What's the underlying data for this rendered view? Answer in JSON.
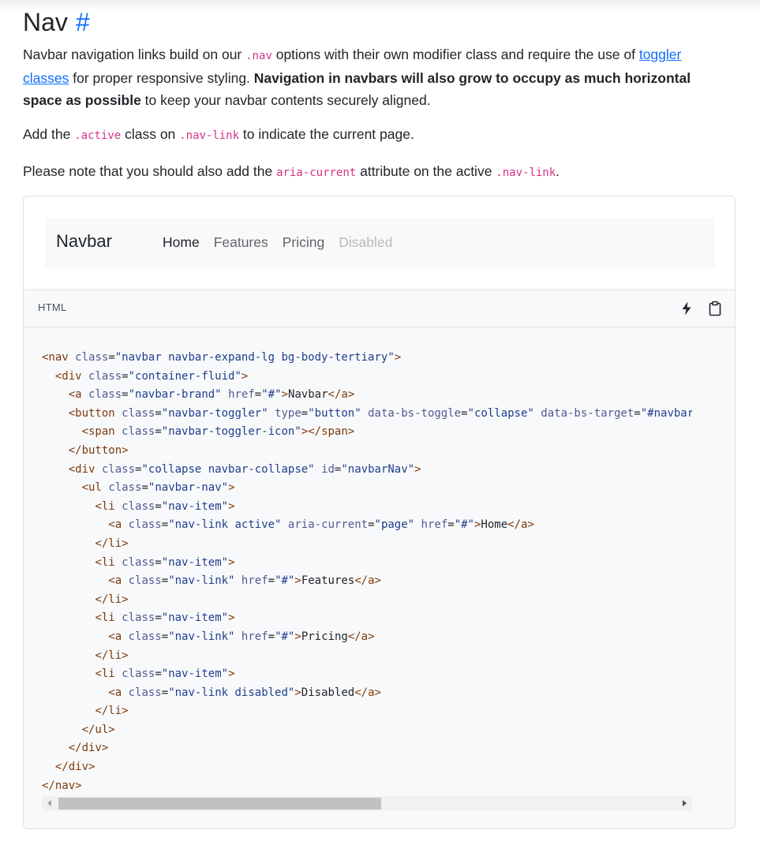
{
  "section": {
    "title": "Nav",
    "anchor": "#"
  },
  "intro": {
    "p1_a": "Navbar navigation links build on our ",
    "p1_code": ".nav",
    "p1_b": " options with their own modifier class and require the use of ",
    "p1_link": "toggler classes",
    "p1_c": " for proper responsive styling. ",
    "p1_bold": "Navigation in navbars will also grow to occupy as much horizontal space as possible",
    "p1_d": " to keep your navbar contents securely aligned.",
    "p2_a": "Add the ",
    "p2_code1": ".active",
    "p2_b": " class on ",
    "p2_code2": ".nav-link",
    "p2_c": " to indicate the current page.",
    "p3_a": "Please note that you should also add the ",
    "p3_code1": "aria-current",
    "p3_b": " attribute on the active ",
    "p3_code2": ".nav-link",
    "p3_c": "."
  },
  "preview": {
    "brand": "Navbar",
    "links": [
      {
        "label": "Home",
        "state": "active"
      },
      {
        "label": "Features",
        "state": "normal"
      },
      {
        "label": "Pricing",
        "state": "normal"
      },
      {
        "label": "Disabled",
        "state": "disabled"
      }
    ]
  },
  "code": {
    "language": "HTML",
    "icons": [
      "lightning-icon",
      "clipboard-icon"
    ],
    "lines": [
      "<nav class=\"navbar navbar-expand-lg bg-body-tertiary\">",
      "  <div class=\"container-fluid\">",
      "    <a class=\"navbar-brand\" href=\"#\">Navbar</a>",
      "    <button class=\"navbar-toggler\" type=\"button\" data-bs-toggle=\"collapse\" data-bs-target=\"#navbarNav\" aria-controls=\"navbarNav\" aria-expanded=\"false\" aria-label=\"Toggle navigation\">",
      "      <span class=\"navbar-toggler-icon\"></span>",
      "    </button>",
      "    <div class=\"collapse navbar-collapse\" id=\"navbarNav\">",
      "      <ul class=\"navbar-nav\">",
      "        <li class=\"nav-item\">",
      "          <a class=\"nav-link active\" aria-current=\"page\" href=\"#\">Home</a>",
      "        </li>",
      "        <li class=\"nav-item\">",
      "          <a class=\"nav-link\" href=\"#\">Features</a>",
      "        </li>",
      "        <li class=\"nav-item\">",
      "          <a class=\"nav-link\" href=\"#\">Pricing</a>",
      "        </li>",
      "        <li class=\"nav-item\">",
      "          <a class=\"nav-link disabled\">Disabled</a>",
      "        </li>",
      "      </ul>",
      "    </div>",
      "  </div>",
      "</nav>"
    ]
  },
  "colors": {
    "link": "#0d6efd",
    "code_inline": "#d63384",
    "navbar_bg": "#f8f9fa",
    "border": "#dee2e6"
  }
}
